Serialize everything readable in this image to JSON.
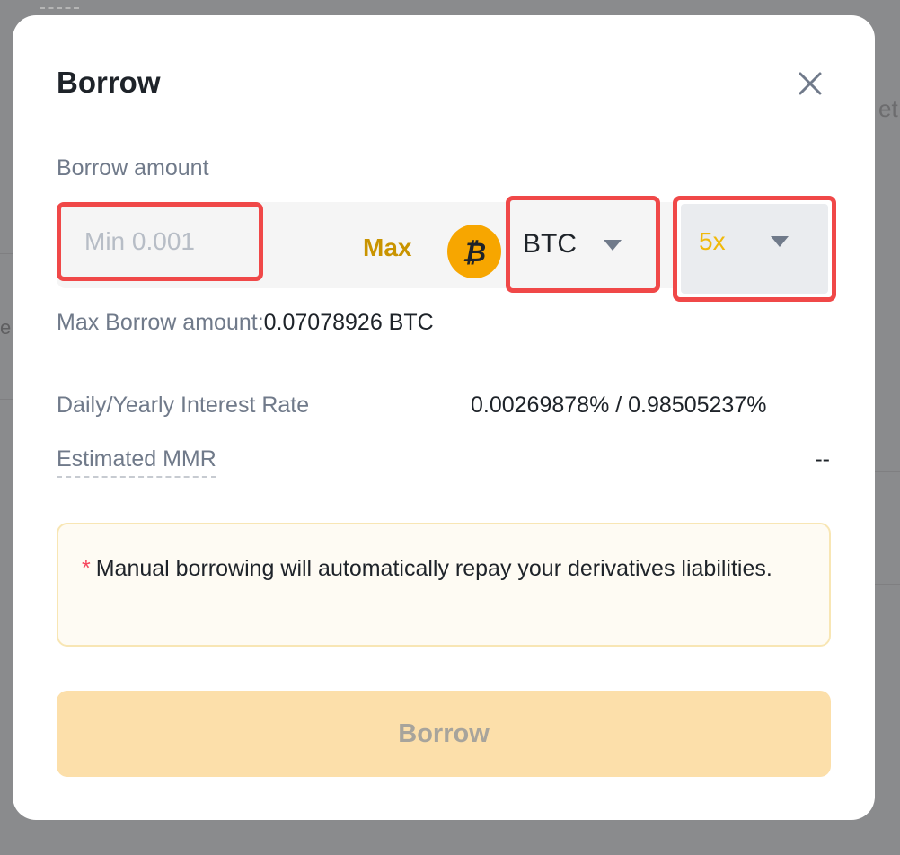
{
  "modal": {
    "title": "Borrow",
    "borrow_amount_label": "Borrow amount",
    "amount_input": {
      "value": "",
      "placeholder": "Min 0.001"
    },
    "max_label": "Max",
    "coin_select": {
      "value": "BTC",
      "icon": "bitcoin-icon"
    },
    "leverage_select": {
      "value": "5x"
    },
    "max_borrow": {
      "label": "Max Borrow amount:",
      "value": "0.07078926 BTC"
    },
    "interest": {
      "label": "Daily/Yearly Interest Rate",
      "value": "0.00269878% / 0.98505237%"
    },
    "mmr": {
      "label": "Estimated MMR",
      "value": "--"
    },
    "notice": {
      "marker": "*",
      "text": "Manual borrowing will automatically repay your derivatives liabilities."
    },
    "submit_label": "Borrow"
  },
  "colors": {
    "accent": "#F0B90B",
    "max_link": "#C99400",
    "highlight_border": "#F04848",
    "button_disabled_bg": "#FCDFAA"
  }
}
